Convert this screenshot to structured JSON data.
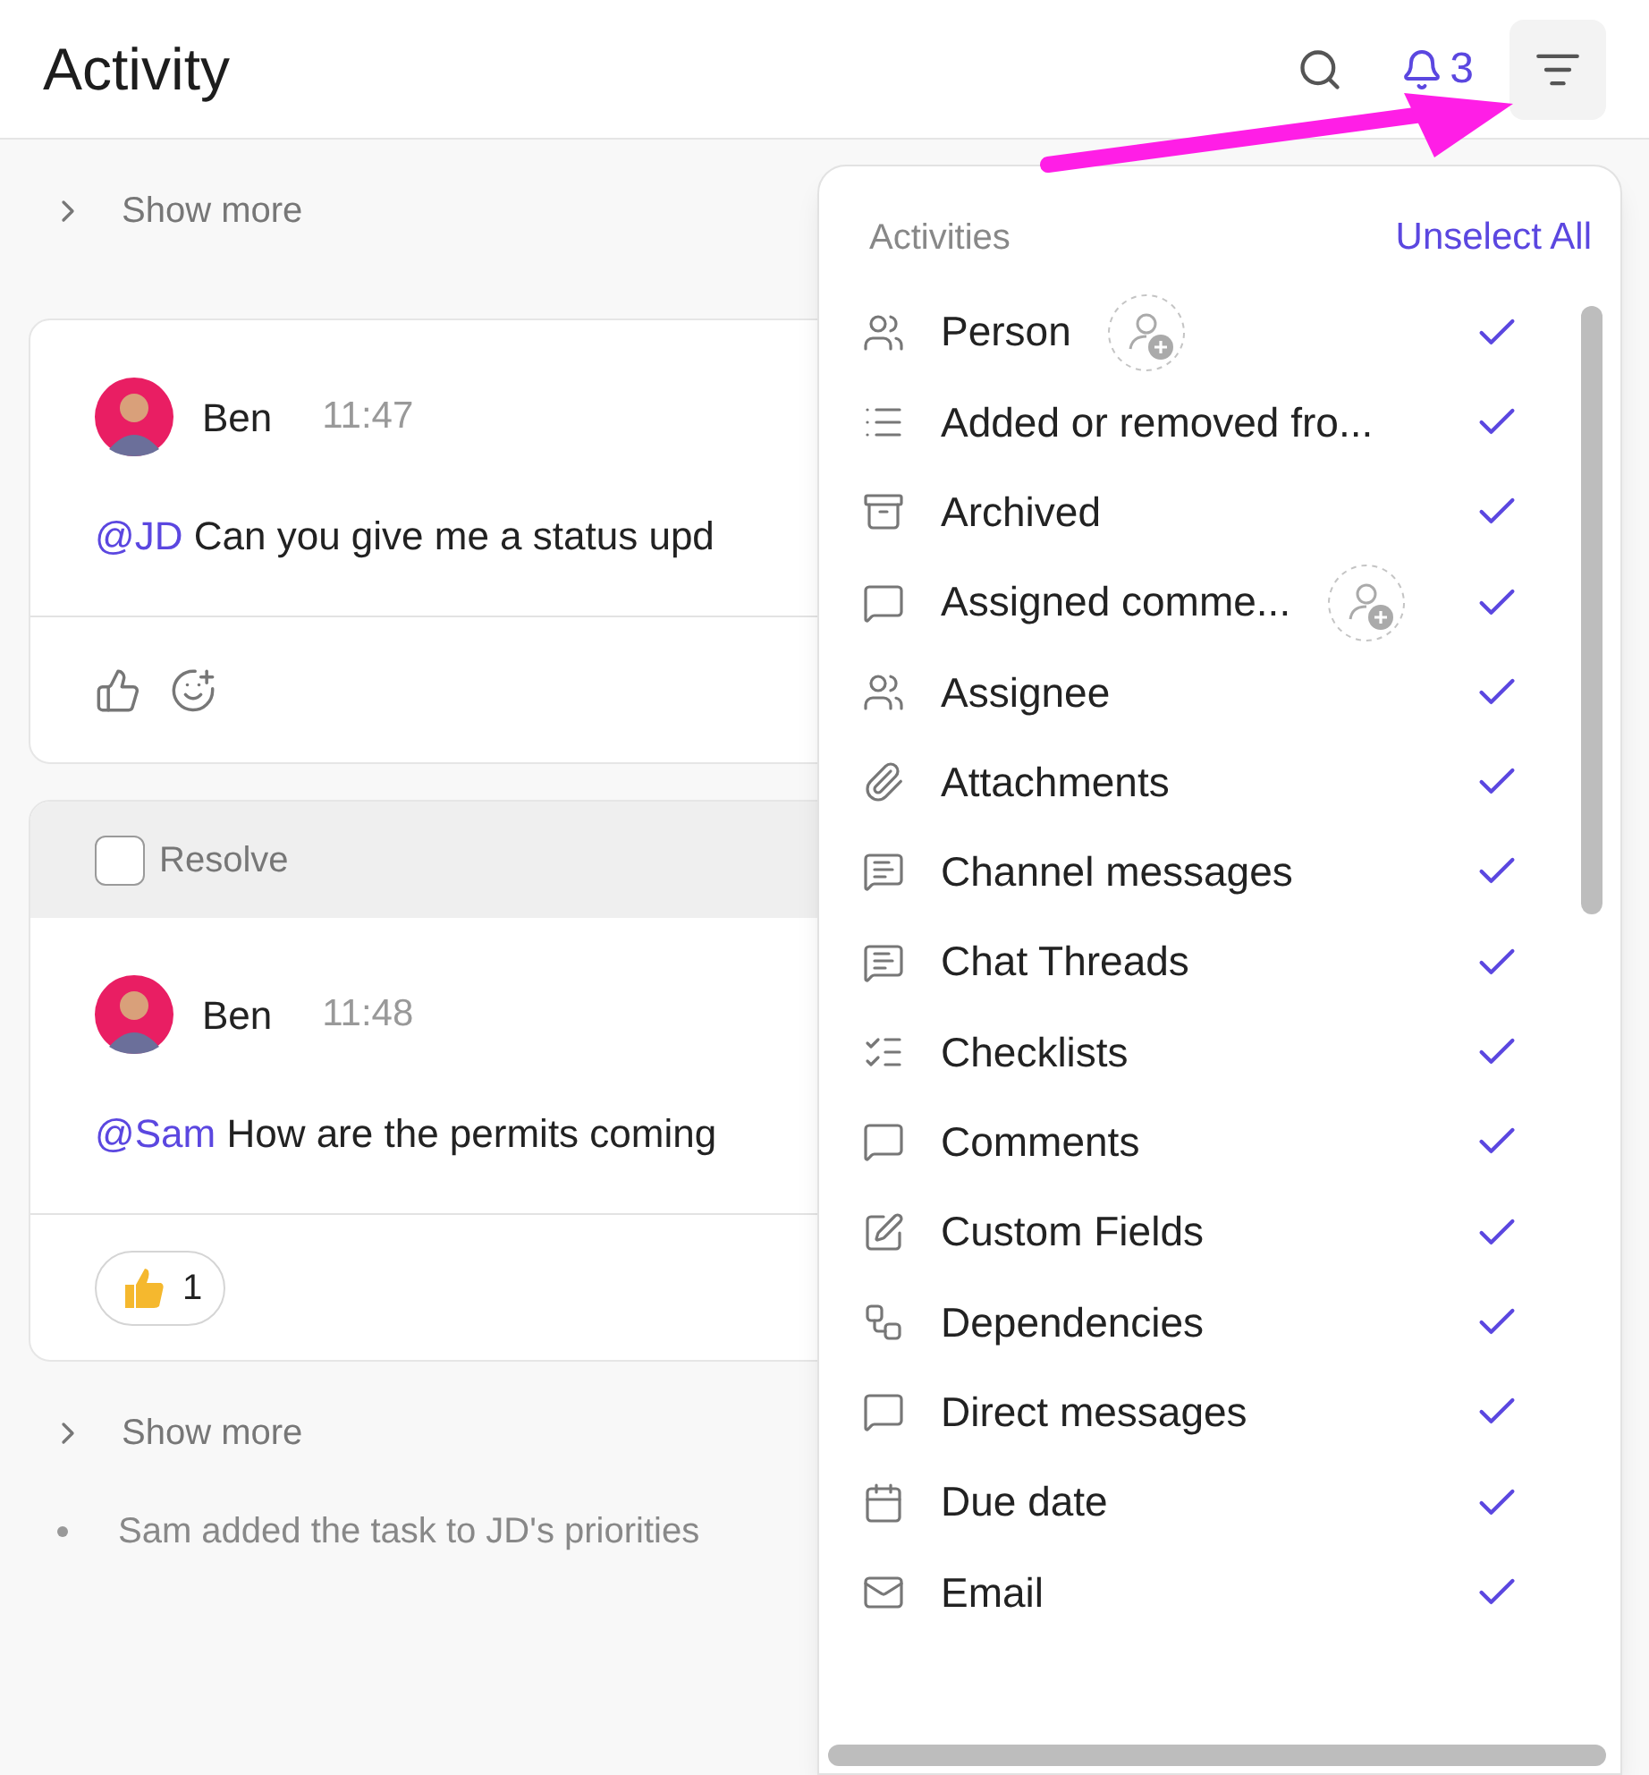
{
  "header": {
    "title": "Activity",
    "notification_count": "3"
  },
  "feed": {
    "show_more_top": "Show more",
    "comments": [
      {
        "author": "Ben",
        "time": "11:47",
        "mention": "@JD",
        "text": "Can you give me a status upd"
      },
      {
        "author": "Ben",
        "time": "11:48",
        "mention": "@Sam",
        "text": "How are the permits coming",
        "resolve": {
          "label": "Resolve",
          "checked": false
        },
        "reactions": [
          {
            "count": "1"
          }
        ]
      }
    ],
    "show_more_bottom": "Show more",
    "event": "Sam added the task to JD's priorities"
  },
  "filter_panel": {
    "heading": "Activities",
    "unselect_all": "Unselect All",
    "items": [
      {
        "label": "Person",
        "checked": true,
        "person_picker": true
      },
      {
        "label": "Added or removed fro...",
        "checked": true,
        "person_picker": false
      },
      {
        "label": "Archived",
        "checked": true,
        "person_picker": false
      },
      {
        "label": "Assigned comme...",
        "checked": true,
        "person_picker": true
      },
      {
        "label": "Assignee",
        "checked": true,
        "person_picker": false
      },
      {
        "label": "Attachments",
        "checked": true,
        "person_picker": false
      },
      {
        "label": "Channel messages",
        "checked": true,
        "person_picker": false
      },
      {
        "label": "Chat Threads",
        "checked": true,
        "person_picker": false
      },
      {
        "label": "Checklists",
        "checked": true,
        "person_picker": false
      },
      {
        "label": "Comments",
        "checked": true,
        "person_picker": false
      },
      {
        "label": "Custom Fields",
        "checked": true,
        "person_picker": false
      },
      {
        "label": "Dependencies",
        "checked": true,
        "person_picker": false
      },
      {
        "label": "Direct messages",
        "checked": true,
        "person_picker": false
      },
      {
        "label": "Due date",
        "checked": true,
        "person_picker": false
      },
      {
        "label": "Email",
        "checked": true,
        "person_picker": false
      }
    ]
  }
}
